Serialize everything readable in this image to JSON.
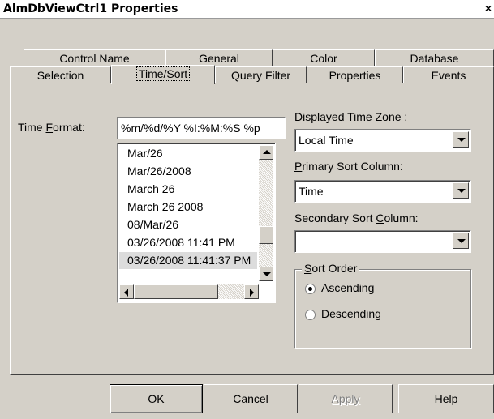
{
  "window": {
    "title": "AlmDbViewCtrl1 Properties",
    "close_glyph": "×"
  },
  "tabs_back": [
    "Control Name",
    "General",
    "Color",
    "Database"
  ],
  "tabs_front": [
    "Selection",
    "Time/Sort",
    "Query Filter",
    "Properties",
    "Events"
  ],
  "active_tab": "Time/Sort",
  "time_format": {
    "label_pre": "Time ",
    "label_u": "F",
    "label_post": "ormat:",
    "value": "%m/%d/%Y %I:%M:%S %p",
    "options": [
      "Mar/26",
      "Mar/26/2008",
      "March 26",
      "March 26 2008",
      "08/Mar/26",
      "03/26/2008 11:41 PM",
      "03/26/2008 11:41:37 PM"
    ],
    "selected_index": 6
  },
  "time_zone": {
    "label_pre": "Displayed Time ",
    "label_u": "Z",
    "label_post": "one :",
    "value": "Local Time"
  },
  "primary_sort": {
    "label_u": "P",
    "label_post": "rimary Sort Column:",
    "value": "Time"
  },
  "secondary_sort": {
    "label_pre": "Secondary Sort ",
    "label_u": "C",
    "label_post": "olumn:",
    "value": ""
  },
  "sort_order": {
    "label_u": "S",
    "label_post": "ort Order",
    "options": [
      "Ascending",
      "Descending"
    ],
    "selected": "Ascending"
  },
  "buttons": {
    "ok": "OK",
    "cancel": "Cancel",
    "apply": "Apply",
    "help": "Help"
  },
  "colors": {
    "face": "#d4d0c8",
    "highlight": "#ffffff",
    "shadow": "#808080",
    "dark_shadow": "#404040",
    "selection": "#dcdcdc"
  }
}
